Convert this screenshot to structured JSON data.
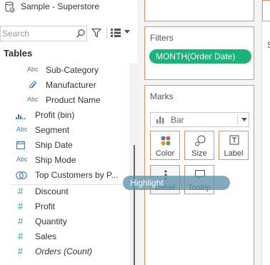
{
  "datasource": {
    "name": "Sample - Superstore",
    "icon": "datasource-cylinder-icon"
  },
  "search": {
    "placeholder": "Search"
  },
  "tables_heading": "Tables",
  "fields": [
    {
      "name": "Sub-Category",
      "type_label": "Abc",
      "icon": "string-type-icon",
      "italic": false
    },
    {
      "name": "Manufacturer",
      "type_label": "",
      "icon": "paperclip-group-icon",
      "italic": false
    },
    {
      "name": "Product Name",
      "type_label": "Abc",
      "icon": "string-type-icon",
      "italic": false
    },
    {
      "name": "Profit (bin)",
      "type_label": "",
      "icon": "bin-histogram-icon",
      "italic": false
    },
    {
      "name": "Segment",
      "type_label": "Abc",
      "icon": "string-type-icon",
      "italic": false
    },
    {
      "name": "Ship Date",
      "type_label": "",
      "icon": "calendar-icon",
      "italic": false
    },
    {
      "name": "Ship Mode",
      "type_label": "Abc",
      "icon": "string-type-icon",
      "italic": false
    },
    {
      "name": "Top Customers by P...",
      "type_label": "",
      "icon": "set-circles-icon",
      "italic": false
    },
    {
      "name": "Discount",
      "type_label": "#",
      "icon": "number-hash-icon",
      "italic": false
    },
    {
      "name": "Profit",
      "type_label": "#",
      "icon": "number-hash-icon",
      "italic": false
    },
    {
      "name": "Quantity",
      "type_label": "#",
      "icon": "number-hash-icon",
      "italic": false
    },
    {
      "name": "Sales",
      "type_label": "#",
      "icon": "number-hash-icon",
      "italic": false
    },
    {
      "name": "Orders (Count)",
      "type_label": "#",
      "icon": "number-hash-icon",
      "italic": true
    }
  ],
  "filters": {
    "title": "Filters",
    "pill": "MONTH(Order Date)",
    "pill_color": "#1ab37a"
  },
  "marks": {
    "title": "Marks",
    "mark_type": "Bar",
    "buttons": [
      {
        "label": "Color",
        "icon": "color-dots-icon"
      },
      {
        "label": "Size",
        "icon": "size-circles-icon"
      },
      {
        "label": "Label",
        "icon": "label-text-icon"
      },
      {
        "label": "Detail",
        "icon": "detail-dots-icon"
      },
      {
        "label": "Tooltip",
        "icon": "tooltip-bubble-icon"
      }
    ]
  },
  "drag_tooltip": "Highlight",
  "right_panel_letter": "S",
  "colors": {
    "accent_border": "#ee8d5b",
    "dimension_icon": "#3d7ab5",
    "measure_icon": "#1ab37a",
    "drag_chip": "#6091aa"
  }
}
